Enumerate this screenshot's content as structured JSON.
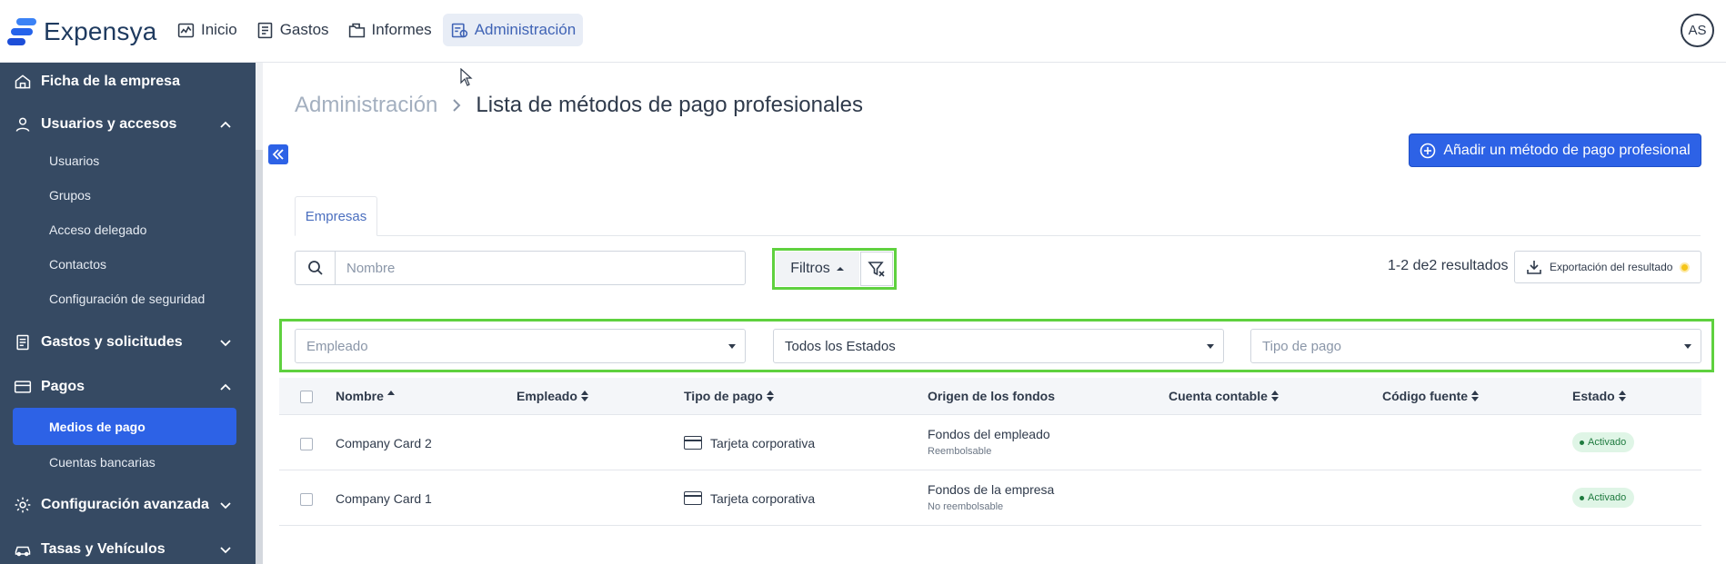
{
  "app": {
    "name": "Expensya",
    "user_initials": "AS"
  },
  "topnav": [
    {
      "label": "Inicio",
      "icon": "chart-icon"
    },
    {
      "label": "Gastos",
      "icon": "receipt-icon"
    },
    {
      "label": "Informes",
      "icon": "folder-icon"
    },
    {
      "label": "Administración",
      "icon": "admin-icon",
      "active": true
    }
  ],
  "sidebar": {
    "sections": [
      {
        "label": "Ficha de la empresa",
        "icon": "home-icon"
      },
      {
        "label": "Usuarios y accesos",
        "icon": "user-icon",
        "expanded": true
      },
      {
        "label": "Gastos y solicitudes",
        "icon": "document-icon",
        "expanded": false
      },
      {
        "label": "Pagos",
        "icon": "wallet-icon",
        "expanded": true
      },
      {
        "label": "Configuración avanzada",
        "icon": "gear-icon",
        "expanded": false
      },
      {
        "label": "Tasas y Vehículos",
        "icon": "car-icon",
        "expanded": false
      }
    ],
    "users_items": [
      "Usuarios",
      "Grupos",
      "Acceso delegado",
      "Contactos",
      "Configuración de seguridad"
    ],
    "payments_items": [
      "Medios de pago",
      "Cuentas bancarias"
    ]
  },
  "breadcrumb": {
    "parent": "Administración",
    "current": "Lista de métodos de pago profesionales"
  },
  "add_button": "Añadir un método de pago profesional",
  "tabs": [
    "Empresas"
  ],
  "search": {
    "placeholder": "Nombre",
    "value": ""
  },
  "filters_label": "Filtros",
  "results_text": "1-2 de2 resultados",
  "export_label": "Exportación del resultado",
  "filter_selects": [
    {
      "placeholder": "Empleado",
      "value": ""
    },
    {
      "placeholder": "",
      "value": "Todos los Estados"
    },
    {
      "placeholder": "Tipo de pago",
      "value": ""
    }
  ],
  "table": {
    "columns": [
      "Nombre",
      "Empleado",
      "Tipo de pago",
      "Origen de los fondos",
      "Cuenta contable",
      "Código fuente",
      "Estado"
    ],
    "rows": [
      {
        "nombre": "Company Card 2",
        "empleado": "",
        "tipo": "Tarjeta corporativa",
        "origen": "Fondos del empleado",
        "origen_sub": "Reembolsable",
        "cuenta": "",
        "codigo": "",
        "estado": "Activado"
      },
      {
        "nombre": "Company Card 1",
        "empleado": "",
        "tipo": "Tarjeta corporativa",
        "origen": "Fondos de la empresa",
        "origen_sub": "No reembolsable",
        "cuenta": "",
        "codigo": "",
        "estado": "Activado"
      }
    ]
  },
  "colors": {
    "accent": "#2d62e6",
    "sidebar": "#364a63",
    "highlight": "#5fd13f",
    "badge_bg": "#dff5e6",
    "badge_text": "#1e7a3e"
  }
}
